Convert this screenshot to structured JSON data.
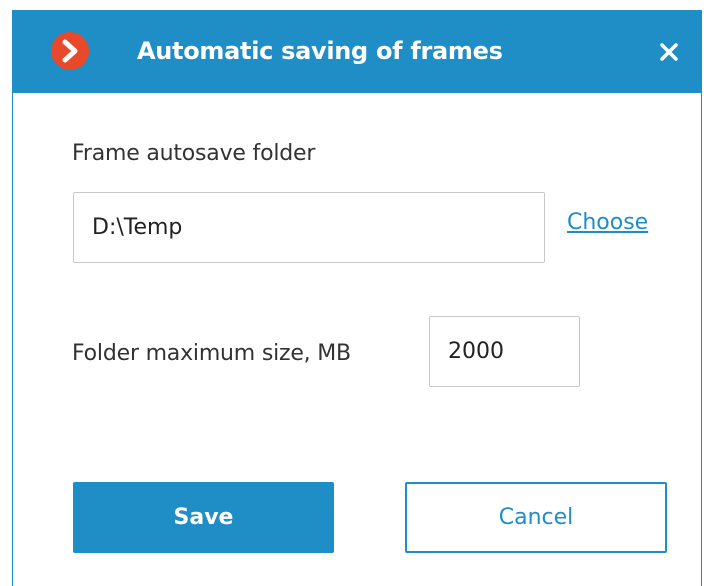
{
  "dialog": {
    "title": "Automatic saving of frames",
    "logo_icon": "app-logo-chevron-icon",
    "close_icon": "close-icon"
  },
  "autosave_folder": {
    "label": "Frame autosave folder",
    "value": "D:\\Temp",
    "choose_label": "Choose"
  },
  "max_size": {
    "label": "Folder maximum size, MB",
    "value": "2000"
  },
  "buttons": {
    "save_label": "Save",
    "cancel_label": "Cancel"
  },
  "colors": {
    "accent": "#1f8dc6",
    "logo": "#e8492a",
    "text": "#333333",
    "border": "#c9c9c9"
  }
}
